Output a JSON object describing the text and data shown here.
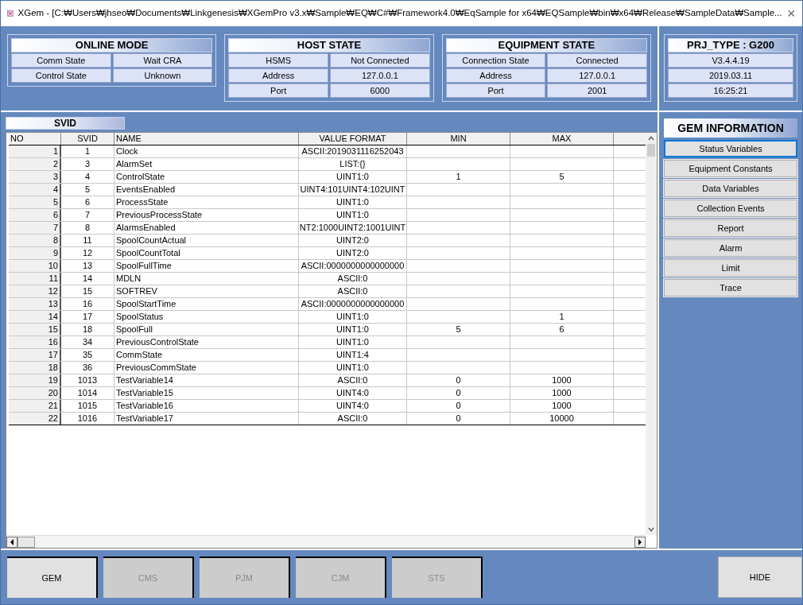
{
  "window": {
    "title": "XGem - [C:₩Users₩jhseo₩Documents₩Linkgenesis₩XGemPro v3.x₩Sample₩EQ₩C#₩Framework4.0₩EqSample for x64₩EQSample₩bin₩x64₩Release₩SampleData₩Sample...",
    "close": "×"
  },
  "status_groups": [
    {
      "title": "ONLINE MODE",
      "rows": [
        [
          "Comm State",
          "Wait CRA"
        ],
        [
          "Control State",
          "Unknown"
        ]
      ]
    },
    {
      "title": "HOST STATE",
      "rows": [
        [
          "HSMS",
          "Not Connected"
        ],
        [
          "Address",
          "127.0.0.1"
        ],
        [
          "Port",
          "6000"
        ]
      ]
    },
    {
      "title": "EQUIPMENT STATE",
      "rows": [
        [
          "Connection State",
          "Connected"
        ],
        [
          "Address",
          "127.0.0.1"
        ],
        [
          "Port",
          "2001"
        ]
      ]
    }
  ],
  "project": {
    "title": "PRJ_TYPE : G200",
    "values": [
      "V3.4.4.19",
      "2019.03.11",
      "16:25:21"
    ]
  },
  "table": {
    "title": "SVID",
    "columns": [
      "NO",
      "SVID",
      "NAME",
      "VALUE FORMAT",
      "MIN",
      "MAX"
    ],
    "rows": [
      [
        "1",
        "1",
        "Clock",
        "ASCII:2019031116252043",
        "",
        ""
      ],
      [
        "2",
        "3",
        "AlarmSet",
        "LIST:{}",
        "",
        ""
      ],
      [
        "3",
        "4",
        "ControlState",
        "UINT1:0",
        "1",
        "5"
      ],
      [
        "4",
        "5",
        "EventsEnabled",
        "UINT4:101UINT4:102UINT",
        "",
        ""
      ],
      [
        "5",
        "6",
        "ProcessState",
        "UINT1:0",
        "",
        ""
      ],
      [
        "6",
        "7",
        "PreviousProcessState",
        "UINT1:0",
        "",
        ""
      ],
      [
        "7",
        "8",
        "AlarmsEnabled",
        "NT2:1000UINT2:1001UINT",
        "",
        ""
      ],
      [
        "8",
        "11",
        "SpoolCountActual",
        "UINT2:0",
        "",
        ""
      ],
      [
        "9",
        "12",
        "SpoolCountTotal",
        "UINT2:0",
        "",
        ""
      ],
      [
        "10",
        "13",
        "SpoolFullTime",
        "ASCII:0000000000000000",
        "",
        ""
      ],
      [
        "11",
        "14",
        "MDLN",
        "ASCII:0",
        "",
        ""
      ],
      [
        "12",
        "15",
        "SOFTREV",
        "ASCII:0",
        "",
        ""
      ],
      [
        "13",
        "16",
        "SpoolStartTime",
        "ASCII:0000000000000000",
        "",
        ""
      ],
      [
        "14",
        "17",
        "SpoolStatus",
        "UINT1:0",
        "",
        "1"
      ],
      [
        "15",
        "18",
        "SpoolFull",
        "UINT1:0",
        "5",
        "6"
      ],
      [
        "16",
        "34",
        "PreviousControlState",
        "UINT1:0",
        "",
        ""
      ],
      [
        "17",
        "35",
        "CommState",
        "UINT1:4",
        "",
        ""
      ],
      [
        "18",
        "36",
        "PreviousCommState",
        "UINT1:0",
        "",
        ""
      ],
      [
        "19",
        "1013",
        "TestVariable14",
        "ASCII:0",
        "0",
        "1000"
      ],
      [
        "20",
        "1014",
        "TestVariable15",
        "UINT4:0",
        "0",
        "1000"
      ],
      [
        "21",
        "1015",
        "TestVariable16",
        "UINT4:0",
        "0",
        "1000"
      ],
      [
        "22",
        "1016",
        "TestVariable17",
        "ASCII:0",
        "0",
        "10000"
      ]
    ]
  },
  "gem_information": {
    "title": "GEM INFORMATION",
    "items": [
      {
        "label": "Status Variables",
        "selected": true
      },
      {
        "label": "Equipment Constants",
        "selected": false
      },
      {
        "label": "Data Variables",
        "selected": false
      },
      {
        "label": "Collection Events",
        "selected": false
      },
      {
        "label": "Report",
        "selected": false
      },
      {
        "label": "Alarm",
        "selected": false
      },
      {
        "label": "Limit",
        "selected": false
      },
      {
        "label": "Trace",
        "selected": false
      }
    ]
  },
  "bottom_buttons": [
    {
      "label": "GEM",
      "disabled": false
    },
    {
      "label": "CMS",
      "disabled": true
    },
    {
      "label": "PJM",
      "disabled": true
    },
    {
      "label": "CJM",
      "disabled": true
    },
    {
      "label": "STS",
      "disabled": true
    }
  ],
  "hide_button": "HIDE"
}
